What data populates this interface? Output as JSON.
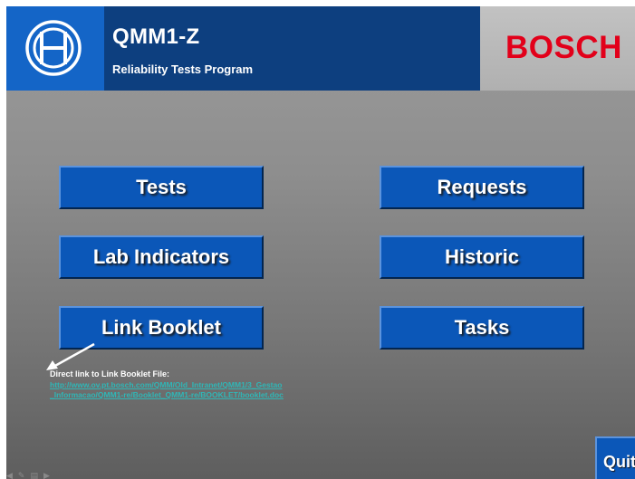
{
  "header": {
    "title": "QMM1-Z",
    "subtitle": "Reliability Tests Program",
    "brand": "BOSCH",
    "logo_icon": "bosch-armature-logo-icon"
  },
  "menu": {
    "tests": "Tests",
    "requests": "Requests",
    "lab_indicators": "Lab Indicators",
    "historic": "Historic",
    "link_booklet": "Link Booklet",
    "tasks": "Tasks"
  },
  "booklet_note": {
    "label": "Direct link to Link Booklet File:",
    "link": "http://www.ov.pt.bosch.com/QMM/Old_Intranet/QMM1/3_Gestao_Informacao/QMM1-re/Booklet_QMM1-re/BOOKLET/booklet.doc"
  },
  "quit_label": "Quit",
  "nav_icons": [
    "back-arrow-icon",
    "pencil-icon",
    "menu-icon",
    "forward-arrow-icon"
  ],
  "colors": {
    "header_blue": "#0d3f7f",
    "logo_blue": "#1465c7",
    "button_blue": "#0b57b8",
    "brand_red": "#e2001a",
    "link_teal": "#2fb6b6"
  }
}
